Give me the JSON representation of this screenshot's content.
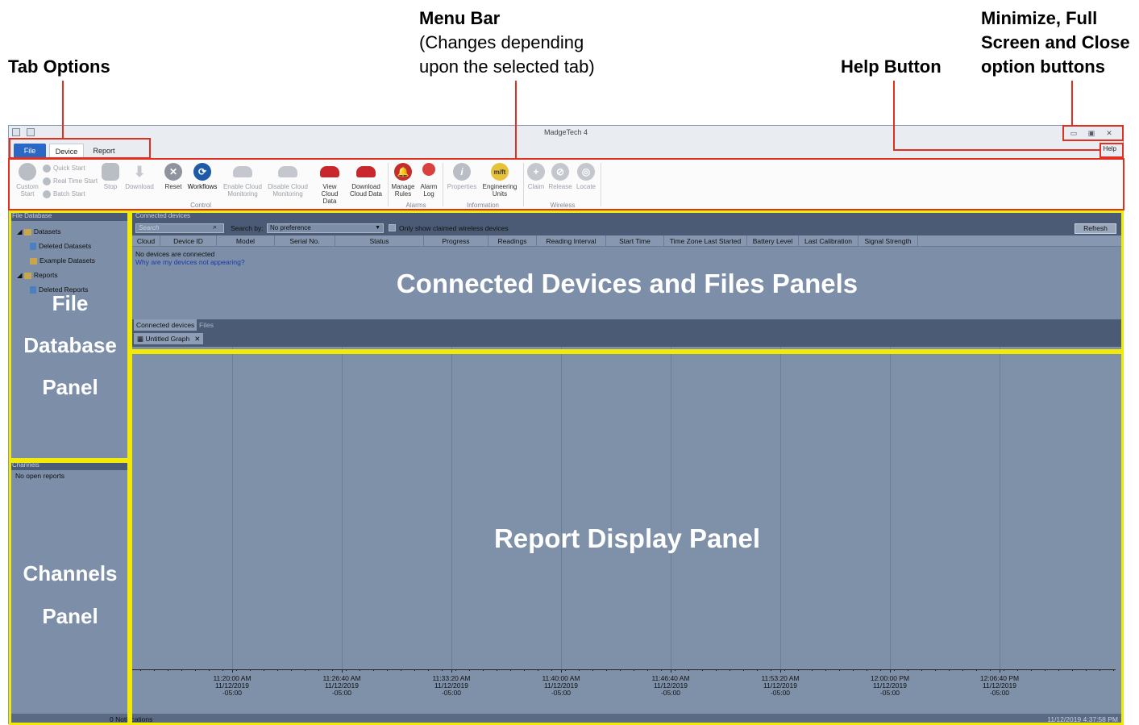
{
  "annotations": {
    "tab_options": "Tab Options",
    "menu_bar_title": "Menu Bar",
    "menu_bar_line1": "(Changes depending",
    "menu_bar_line2": "upon the selected tab)",
    "help_button": "Help Button",
    "minmax_line1": "Minimize, Full",
    "minmax_line2": "Screen and Close",
    "minmax_line3": "option buttons",
    "file_db_line1": "File",
    "file_db_line2": "Database",
    "file_db_line3": "Panel",
    "channels_line1": "Channels",
    "channels_line2": "Panel",
    "connected_panels": "Connected Devices and Files Panels",
    "report_panel": "Report Display Panel"
  },
  "app": {
    "title": "MadgeTech 4",
    "tabs": [
      "File",
      "Device",
      "Report"
    ],
    "help": "Help",
    "window_buttons": {
      "minimize": "▭",
      "maximize": "▣",
      "close": "✕"
    }
  },
  "ribbon": {
    "custom_start": [
      "Custom",
      "Start"
    ],
    "quick_start": "Quick Start",
    "real_time_start": "Real Time Start",
    "batch_start": "Batch Start",
    "stop": "Stop",
    "download": "Download",
    "reset": "Reset",
    "workflows": "Workflows",
    "enable_cloud": [
      "Enable Cloud",
      "Monitoring"
    ],
    "disable_cloud": [
      "Disable Cloud",
      "Monitoring"
    ],
    "view_cloud": [
      "View",
      "Cloud Data"
    ],
    "download_cloud": [
      "Download",
      "Cloud Data"
    ],
    "manage_rules": [
      "Manage",
      "Rules"
    ],
    "alarm_log": [
      "Alarm",
      "Log"
    ],
    "properties": "Properties",
    "engineering_units": [
      "Engineering",
      "Units"
    ],
    "claim": "Claim",
    "release": "Release",
    "locate": "Locate",
    "groups": {
      "control": "Control",
      "alarms": "Alarms",
      "information": "Information",
      "wireless": "Wireless"
    }
  },
  "file_database": {
    "header": "File Database",
    "items": [
      "Datasets",
      "Deleted Datasets",
      "Example Datasets",
      "Reports",
      "Deleted Reports"
    ]
  },
  "channels": {
    "header": "Channels",
    "empty": "No open reports"
  },
  "connected_devices": {
    "header": "Connected devices",
    "search_placeholder": "Search",
    "search_by_label": "Search by:",
    "search_by_value": "No preference",
    "only_claimed": "Only show claimed wireless devices",
    "refresh": "Refresh",
    "columns": [
      "Cloud",
      "Device ID",
      "Model",
      "Serial No.",
      "Status",
      "Progress",
      "Readings",
      "Reading Interval",
      "Start Time",
      "Time Zone Last Started",
      "Battery Level",
      "Last Calibration",
      "Signal Strength"
    ],
    "empty_message": "No devices are connected",
    "help_link": "Why are my devices not appearing?",
    "bottom_tabs": [
      "Connected devices",
      "Files"
    ],
    "document_tab": "Untitled Graph"
  },
  "report": {
    "x_ticks": [
      {
        "time": "11:20:00 AM",
        "date": "11/12/2019",
        "tz": "-05:00"
      },
      {
        "time": "11:26:40 AM",
        "date": "11/12/2019",
        "tz": "-05:00"
      },
      {
        "time": "11:33:20 AM",
        "date": "11/12/2019",
        "tz": "-05:00"
      },
      {
        "time": "11:40:00 AM",
        "date": "11/12/2019",
        "tz": "-05:00"
      },
      {
        "time": "11:46:40 AM",
        "date": "11/12/2019",
        "tz": "-05:00"
      },
      {
        "time": "11:53:20 AM",
        "date": "11/12/2019",
        "tz": "-05:00"
      },
      {
        "time": "12:00:00 PM",
        "date": "11/12/2019",
        "tz": "-05:00"
      },
      {
        "time": "12:06:40 PM",
        "date": "11/12/2019",
        "tz": "-05:00"
      }
    ]
  },
  "status": {
    "notifications": "0 Notifications",
    "clock": "11/12/2019 4:37:58 PM"
  },
  "colors": {
    "annotation_red": "#e1301f",
    "annotation_yellow": "#f1ea07",
    "file_tab_blue": "#2b67c5",
    "panel_bg": "#7d8ea8"
  }
}
